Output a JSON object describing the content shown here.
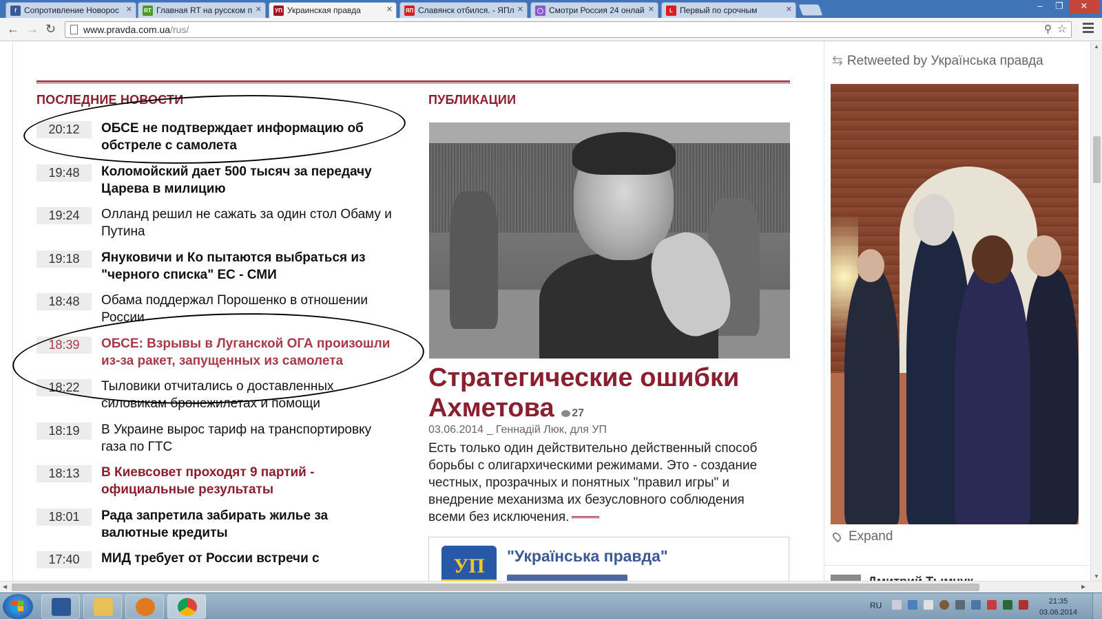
{
  "browser": {
    "tabs": [
      {
        "title": "Сопротивление Новорос",
        "favicon_color": "#3b5998",
        "favicon_text": "f"
      },
      {
        "title": "Главная RT на русском п",
        "favicon_color": "#4a9a2a",
        "favicon_text": "RT"
      },
      {
        "title": "Украинская правда",
        "favicon_color": "#a01424",
        "favicon_text": "УП",
        "active": true
      },
      {
        "title": "Славянск отбился. - ЯПл",
        "favicon_color": "#d81e1e",
        "favicon_text": "ЯП"
      },
      {
        "title": "Смотри Россия 24 онлай",
        "favicon_color": "#8a5ac8",
        "favicon_text": "◯"
      },
      {
        "title": "Первый по срочным",
        "favicon_color": "#d81e1e",
        "favicon_text": "L"
      }
    ],
    "url_domain": "www.pravda.com.ua",
    "url_path": "/rus/"
  },
  "latest_news": {
    "section_title": "ПОСЛЕДНИЕ НОВОСТИ",
    "items": [
      {
        "time": "20:12",
        "title": "ОБСЕ не подтверждает информацию об обстреле с самолета",
        "style": "bold"
      },
      {
        "time": "19:48",
        "title": "Коломойский дает 500 тысяч за передачу Царева в милицию",
        "style": "bold"
      },
      {
        "time": "19:24",
        "title": "Олланд решил не сажать за один стол Обаму и Путина",
        "style": "normal"
      },
      {
        "time": "19:18",
        "title": "Януковичи и Ко пытаются выбраться из \"черного списка\" ЕС - СМИ",
        "style": "bold"
      },
      {
        "time": "18:48",
        "title": "Обама поддержал Порошенко в отношении России",
        "style": "normal"
      },
      {
        "time": "18:39",
        "title": "ОБСЕ: Взрывы в Луганской ОГА произошли из-за ракет, запущенных из самолета",
        "style": "bold-pink"
      },
      {
        "time": "18:22",
        "title": "Тыловики отчитались о доставленных силовикам бронежилетах и помощи",
        "style": "normal"
      },
      {
        "time": "18:19",
        "title": "В Украине вырос тариф на транспортировку газа по ГТС",
        "style": "normal"
      },
      {
        "time": "18:13",
        "title": "В Киевсовет проходят 9 партий - официальные результаты",
        "style": "bold-red"
      },
      {
        "time": "18:01",
        "title": "Рада запретила забирать жилье за валютные кредиты",
        "style": "bold"
      },
      {
        "time": "17:40",
        "title": "МИД требует от России встречи с",
        "style": "bold"
      }
    ]
  },
  "publications": {
    "section_title": "ПУБЛИКАЦИИ",
    "headline": "Стратегические ошибки Ахметова",
    "comments": "27",
    "meta": "03.06.2014 _ Геннадій Люк, для УП",
    "lead": "Есть только один действительно действенный способ борьбы с олигархическими режимами. Это - создание честных, прозрачных и понятных \"правил игры\" и внедрение механизма их безусловного соблюдения всеми без исключения."
  },
  "facebook_box": {
    "logo_text": "УП",
    "page_name": "\"Українська правда\""
  },
  "twitter": {
    "retweeted_by": "Retweeted by Українська правда",
    "expand_label": "Expand",
    "next_author": "Дмитрий Тымчук"
  },
  "taskbar": {
    "lang": "RU",
    "time": "21:35",
    "date": "03.06.2014"
  },
  "colors": {
    "brand": "#8b1f2f",
    "pink_headline": "#a83a4a"
  }
}
